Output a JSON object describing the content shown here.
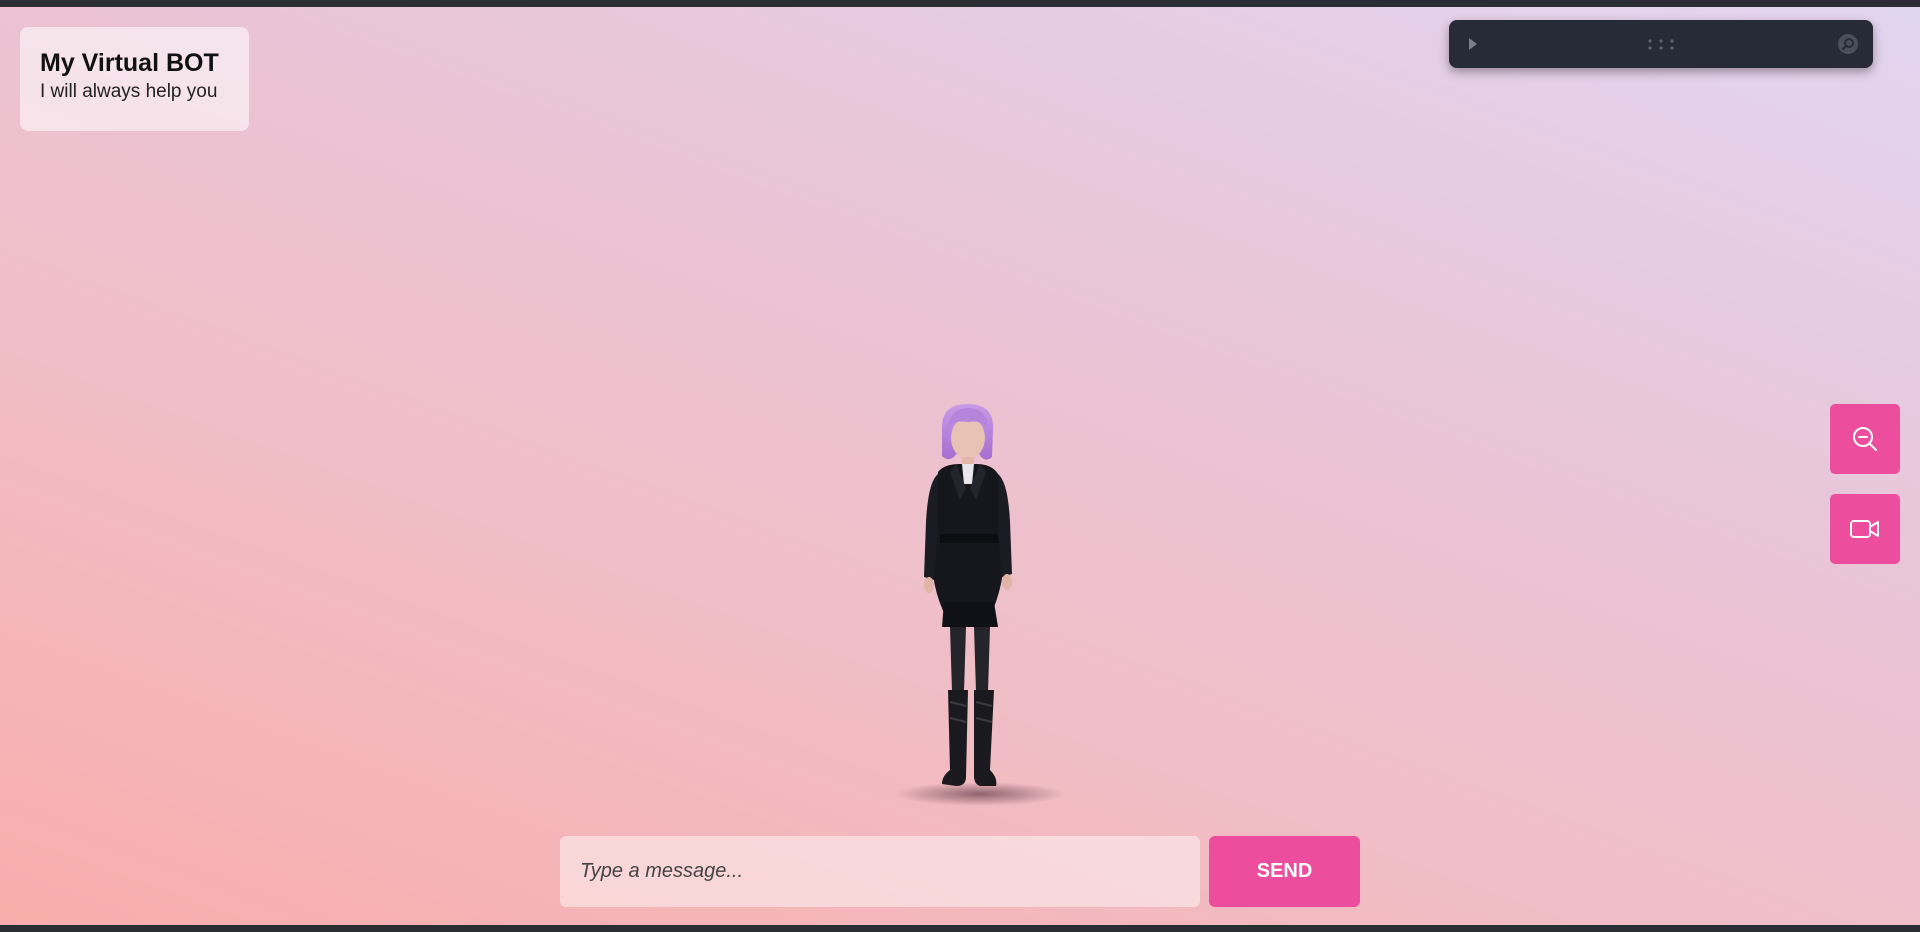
{
  "header": {
    "title": "My Virtual BOT",
    "subtitle": "I will always help you"
  },
  "debug_bar": {
    "icons": [
      "play-icon",
      "drag-handle-icon",
      "search-icon"
    ]
  },
  "side_controls": {
    "zoom_icon": "zoom-out-icon",
    "camera_icon": "video-camera-icon"
  },
  "chat": {
    "placeholder": "Type a message...",
    "value": "",
    "send_label": "SEND"
  },
  "colors": {
    "accent": "#ec4d9c",
    "debug_bar_bg": "#272b36",
    "gradient_start": "#f9adab",
    "gradient_end": "#e2d5f0"
  }
}
